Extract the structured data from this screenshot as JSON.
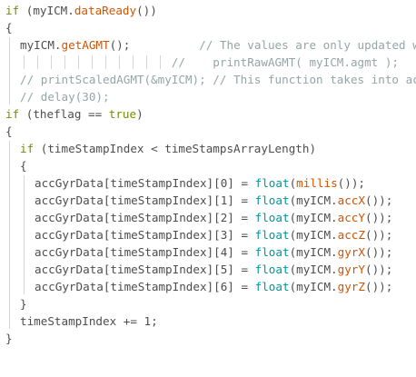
{
  "editor": {
    "colors": {
      "keyword": "#728e00",
      "function": "#d35400",
      "type": "#00979d",
      "comment": "#95a5a6",
      "text": "#4d4d4d",
      "indent_guide": "#d6d6d6"
    },
    "lines": [
      {
        "indent": 0,
        "tokens": [
          {
            "t": "if",
            "c": "kw"
          },
          {
            "t": " (myICM.",
            "c": "tx"
          },
          {
            "t": "dataReady",
            "c": "fn"
          },
          {
            "t": "())",
            "c": "tx"
          }
        ]
      },
      {
        "indent": 0,
        "tokens": [
          {
            "t": "{",
            "c": "tx"
          }
        ]
      },
      {
        "indent": 1,
        "tokens": [
          {
            "t": "myICM.",
            "c": "tx"
          },
          {
            "t": "getAGMT",
            "c": "fn"
          },
          {
            "t": "();          ",
            "c": "tx"
          },
          {
            "t": "// The values are only updated when new data is available",
            "c": "cm"
          }
        ]
      },
      {
        "indent": 1,
        "tokens": [
          {
            "t": "                      //    printRawAGMT( myICM.agmt );",
            "c": "cm"
          }
        ]
      },
      {
        "indent": 1,
        "tokens": [
          {
            "t": "// printScaledAGMT(&myICM); // This function takes into account the scale settings",
            "c": "cm"
          }
        ]
      },
      {
        "indent": 1,
        "tokens": [
          {
            "t": "// delay(30);",
            "c": "cm"
          }
        ]
      },
      {
        "indent": 0,
        "tokens": [
          {
            "t": "if",
            "c": "kw"
          },
          {
            "t": " (theflag == ",
            "c": "tx"
          },
          {
            "t": "true",
            "c": "kw"
          },
          {
            "t": ")",
            "c": "tx"
          }
        ]
      },
      {
        "indent": 0,
        "tokens": [
          {
            "t": "{",
            "c": "tx"
          }
        ]
      },
      {
        "indent": 1,
        "tokens": [
          {
            "t": "if",
            "c": "kw"
          },
          {
            "t": " (timeStampIndex < timeStampsArrayLength)",
            "c": "tx"
          }
        ]
      },
      {
        "indent": 1,
        "tokens": [
          {
            "t": "{",
            "c": "tx"
          }
        ]
      },
      {
        "indent": 2,
        "tokens": [
          {
            "t": "accGyrData[timeStampIndex][0] = ",
            "c": "tx"
          },
          {
            "t": "float",
            "c": "ty"
          },
          {
            "t": "(",
            "c": "tx"
          },
          {
            "t": "millis",
            "c": "fn"
          },
          {
            "t": "());",
            "c": "tx"
          }
        ]
      },
      {
        "indent": 2,
        "tokens": [
          {
            "t": "accGyrData[timeStampIndex][1] = ",
            "c": "tx"
          },
          {
            "t": "float",
            "c": "ty"
          },
          {
            "t": "(myICM.",
            "c": "tx"
          },
          {
            "t": "accX",
            "c": "fn"
          },
          {
            "t": "());",
            "c": "tx"
          }
        ]
      },
      {
        "indent": 2,
        "tokens": [
          {
            "t": "accGyrData[timeStampIndex][2] = ",
            "c": "tx"
          },
          {
            "t": "float",
            "c": "ty"
          },
          {
            "t": "(myICM.",
            "c": "tx"
          },
          {
            "t": "accY",
            "c": "fn"
          },
          {
            "t": "());",
            "c": "tx"
          }
        ]
      },
      {
        "indent": 2,
        "tokens": [
          {
            "t": "accGyrData[timeStampIndex][3] = ",
            "c": "tx"
          },
          {
            "t": "float",
            "c": "ty"
          },
          {
            "t": "(myICM.",
            "c": "tx"
          },
          {
            "t": "accZ",
            "c": "fn"
          },
          {
            "t": "());",
            "c": "tx"
          }
        ]
      },
      {
        "indent": 2,
        "tokens": [
          {
            "t": "accGyrData[timeStampIndex][4] = ",
            "c": "tx"
          },
          {
            "t": "float",
            "c": "ty"
          },
          {
            "t": "(myICM.",
            "c": "tx"
          },
          {
            "t": "gyrX",
            "c": "fn"
          },
          {
            "t": "());",
            "c": "tx"
          }
        ]
      },
      {
        "indent": 2,
        "tokens": [
          {
            "t": "accGyrData[timeStampIndex][5] = ",
            "c": "tx"
          },
          {
            "t": "float",
            "c": "ty"
          },
          {
            "t": "(myICM.",
            "c": "tx"
          },
          {
            "t": "gyrY",
            "c": "fn"
          },
          {
            "t": "());",
            "c": "tx"
          }
        ]
      },
      {
        "indent": 2,
        "tokens": [
          {
            "t": "accGyrData[timeStampIndex][6] = ",
            "c": "tx"
          },
          {
            "t": "float",
            "c": "ty"
          },
          {
            "t": "(myICM.",
            "c": "tx"
          },
          {
            "t": "gyrZ",
            "c": "fn"
          },
          {
            "t": "());",
            "c": "tx"
          }
        ]
      },
      {
        "indent": 1,
        "tokens": [
          {
            "t": "}",
            "c": "tx"
          }
        ]
      },
      {
        "indent": 1,
        "tokens": [
          {
            "t": "timeStampIndex += ",
            "c": "tx"
          },
          {
            "t": "1",
            "c": "tx"
          },
          {
            "t": ";",
            "c": "tx"
          }
        ]
      },
      {
        "indent": 0,
        "tokens": [
          {
            "t": "}",
            "c": "tx"
          }
        ]
      }
    ]
  }
}
